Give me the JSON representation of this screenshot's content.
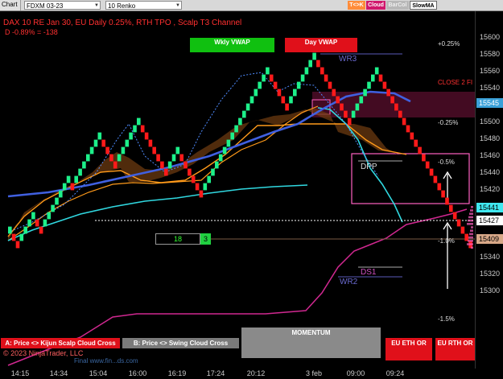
{
  "toolbar": {
    "chart_tab": "Chart",
    "instrument": "FDXM 03-23",
    "bar_type": "10 Renko",
    "buttons": [
      "T<>K",
      "Cloud",
      "BarCol",
      "SlowMA"
    ]
  },
  "header": {
    "title": "DAX 10  RE Jan 30, EU Daily 0.25%, RTH TPO , Scalp T3 Channel",
    "delta": "D -0.89% = -138"
  },
  "vwap_labels": {
    "weekly": "Wkly VWAP",
    "day": "Day VWAP"
  },
  "level_labels": {
    "wr3": "WR3",
    "close2": "CLOSE 2 FI",
    "dpp": "DPP",
    "ds1": "DS1",
    "wr2": "WR2",
    "plus025": "+0.25%",
    "minus025": "-0.25%",
    "minus05": "-0.5%",
    "minus1": "-1.0%",
    "minus15": "-1.5%"
  },
  "counter": {
    "value": "18",
    "badge": "3"
  },
  "y_axis": {
    "ticks": [
      "15600",
      "15580",
      "15560",
      "15540",
      "15520",
      "15500",
      "15480",
      "15460",
      "15440",
      "15420",
      "15400",
      "15380",
      "15360",
      "15340",
      "15320",
      "15300"
    ],
    "tags": [
      {
        "text": "15545",
        "color": "#3aa0d8",
        "fg": "#ffffff"
      },
      {
        "text": "15441",
        "color": "#40e8f0",
        "fg": "#000000"
      },
      {
        "text": "15427",
        "color": "#ffffff",
        "fg": "#000000"
      },
      {
        "text": "15409",
        "color": "#d8a888",
        "fg": "#000000"
      }
    ]
  },
  "x_axis": {
    "ticks": [
      "14:15",
      "14:34",
      "15:04",
      "16:00",
      "16:19",
      "17:24",
      "20:12",
      "3 feb",
      "09:00",
      "09:24"
    ]
  },
  "bottom_buttons": {
    "a": "A: Price <> Kijun Scalp Cloud Cross",
    "b": "B: Price <> Swing Cloud Cross",
    "momentum": "MOMENTUM",
    "eu_eth": "EU ETH OR",
    "eu_rth": "EU RTH OR"
  },
  "copyright": "© 2023 NinjaTrader, LLC",
  "watermark": "Final  www.fin...ds.com",
  "colors": {
    "up_brick": "#1df08a",
    "down_brick": "#ff1a1a",
    "orange": "#ff9a1a",
    "blue_ma": "#4060e0",
    "cyan": "#30d8e0",
    "magenta": "#d02890",
    "pink_box": "#ff60c0"
  }
}
